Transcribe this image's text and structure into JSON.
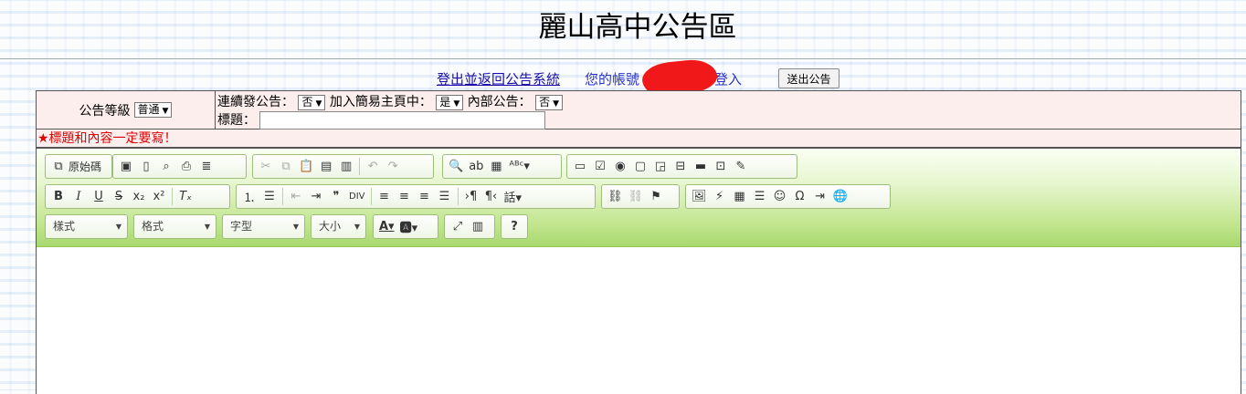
{
  "page": {
    "title": "麗山高中公告區"
  },
  "topbar": {
    "logout_link": "登出並返回公告系統",
    "account_text": "您的帳號",
    "account_suffix": "登入",
    "submit_button": "送出公告"
  },
  "form": {
    "level_label": "公告等級",
    "level_value": "普通",
    "continuous_label": "連續發公告：",
    "continuous_value": "否",
    "homepage_label": "加入簡易主頁中：",
    "homepage_value": "是",
    "internal_label": "內部公告：",
    "internal_value": "否",
    "title_label": "標題：",
    "title_value": "",
    "warning": "★標題和內容一定要寫！"
  },
  "toolbar": {
    "source_label": "原始碼",
    "combos": {
      "style": "樣式",
      "format": "格式",
      "font": "字型",
      "size": "大小"
    }
  },
  "icons": {
    "source": "source-icon",
    "save": "save-icon",
    "new_page": "new-page-icon",
    "preview": "preview-icon",
    "print": "print-icon",
    "templates": "templates-icon",
    "cut": "cut-icon",
    "copy": "copy-icon",
    "paste": "paste-icon",
    "paste_text": "paste-text-icon",
    "paste_word": "paste-word-icon",
    "undo": "undo-icon",
    "redo": "redo-icon",
    "find": "find-icon",
    "replace": "replace-icon",
    "select_all": "select-all-icon",
    "spellcheck": "spellcheck-icon",
    "form": "form-icon",
    "checkbox": "checkbox-icon",
    "radio": "radio-icon",
    "textfield": "textfield-icon",
    "textarea": "textarea-icon",
    "select": "select-icon",
    "button": "button-icon",
    "image_button": "image-button-icon",
    "hidden_field": "hidden-field-icon",
    "bold": "bold-icon",
    "italic": "italic-icon",
    "underline": "underline-icon",
    "strike": "strike-icon",
    "subscript": "subscript-icon",
    "superscript": "superscript-icon",
    "remove_format": "remove-format-icon",
    "numbered_list": "numbered-list-icon",
    "bulleted_list": "bulleted-list-icon",
    "outdent": "outdent-icon",
    "indent": "indent-icon",
    "blockquote": "blockquote-icon",
    "div": "div-icon",
    "align_left": "align-left-icon",
    "align_center": "align-center-icon",
    "align_right": "align-right-icon",
    "justify": "justify-icon",
    "ltr": "ltr-icon",
    "rtl": "rtl-icon",
    "language": "language-icon",
    "link": "link-icon",
    "unlink": "unlink-icon",
    "anchor": "anchor-icon",
    "image": "image-icon",
    "flash": "flash-icon",
    "table": "table-icon",
    "hr": "horizontal-line-icon",
    "smiley": "smiley-icon",
    "special_char": "special-char-icon",
    "page_break": "page-break-icon",
    "iframe": "iframe-icon",
    "text_color": "text-color-icon",
    "bg_color": "bg-color-icon",
    "maximize": "maximize-icon",
    "show_blocks": "show-blocks-icon",
    "about": "about-icon"
  }
}
